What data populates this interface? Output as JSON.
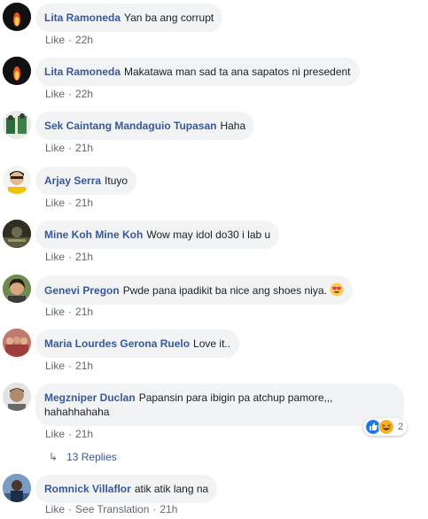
{
  "comments": [
    {
      "author": "Lita Ramoneda",
      "text": "Yan ba ang corrupt",
      "like": "Like",
      "time": "22h"
    },
    {
      "author": "Lita Ramoneda",
      "text": "Makatawa man sad ta ana sapatos ni presedent",
      "like": "Like",
      "time": "22h"
    },
    {
      "author": "Sek Caintang Mandaguio Tupasan",
      "text": "Haha",
      "like": "Like",
      "time": "21h"
    },
    {
      "author": "Arjay Serra",
      "text": "Ituyo",
      "like": "Like",
      "time": "21h"
    },
    {
      "author": "Mine Koh Mine Koh",
      "text": "Wow may idol do30 i lab u",
      "like": "Like",
      "time": "21h"
    },
    {
      "author": "Genevi Pregon",
      "text": "Pwde pana ipadikit ba nice ang shoes niya.",
      "like": "Like",
      "time": "21h"
    },
    {
      "author": "Maria Lourdes Gerona Ruelo",
      "text": "Love it..",
      "like": "Like",
      "time": "21h"
    },
    {
      "author": "Megzniper Duclan",
      "text": "Papansin para ibigin pa atchup pamore,,, hahahhahaha",
      "like": "Like",
      "time": "21h",
      "reaction_count": "2"
    },
    {
      "author": "Romnick Villaflor",
      "text": "atik atik lang na",
      "like": "Like",
      "see_translation": "See Translation",
      "time": "21h"
    }
  ],
  "replies": {
    "arrow": "↳",
    "label": "13 Replies"
  },
  "colors": {
    "link": "#385898",
    "bubble": "#f2f3f5",
    "meta": "#606770"
  }
}
